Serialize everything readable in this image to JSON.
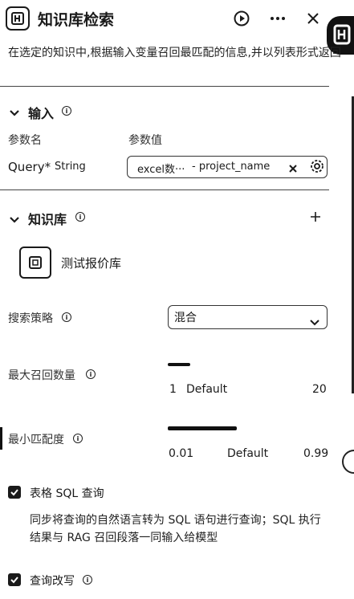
{
  "header": {
    "title": "知识库检索",
    "description": "在选定的知识中,根据输入变量召回最匹配的信息,并以列表形式返回"
  },
  "input_section": {
    "title": "输入",
    "param_name_header": "参数名",
    "param_value_header": "参数值",
    "param": {
      "name": "Query*",
      "type": "String",
      "value_source": "excel数···",
      "value_field": "- project_name"
    }
  },
  "knowledge_section": {
    "title": "知识库",
    "item_name": "测试报价库"
  },
  "search_strategy": {
    "label": "搜索策略",
    "selected": "混合"
  },
  "max_recall": {
    "label": "最大召回数量",
    "min": "1",
    "default_label": "Default",
    "max": "20",
    "value_fraction": 0.14
  },
  "min_match": {
    "label": "最小匹配度",
    "min": "0.01",
    "default_label": "Default",
    "max": "0.99",
    "value_fraction": 0.43
  },
  "table_sql": {
    "label": "表格 SQL 查询",
    "checked": true,
    "description": "同步将查询的自然语言转为 SQL 语句进行查询；SQL 执行结果与 RAG 召回段落一同输入给模型"
  },
  "query_rewrite": {
    "label": "查询改写",
    "checked": true
  },
  "colors": {
    "text": "#1a1a1a",
    "border": "#333333"
  }
}
